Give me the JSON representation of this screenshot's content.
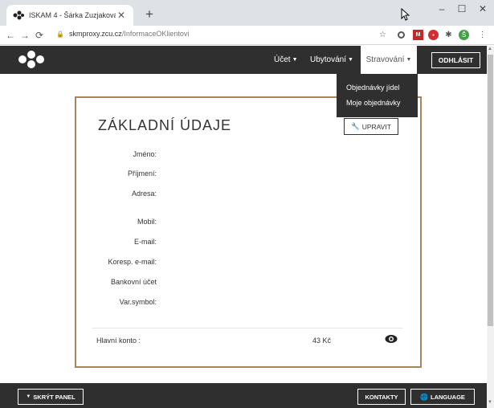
{
  "browser": {
    "tab_title": "ISKAM 4 - Šárka Zuzjaková",
    "url_domain": "skmproxy.zcu.cz",
    "url_path": "/InformaceOKlientovi"
  },
  "header": {
    "nav": [
      "Účet",
      "Ubytování",
      "Stravování"
    ],
    "logout": "ODHLÁSIT"
  },
  "dropdown": {
    "items": [
      "Objednávky jídel",
      "Moje objednávky"
    ]
  },
  "card": {
    "title": "ZÁKLADNÍ ÚDAJE",
    "edit": "UPRAVIT",
    "fields": [
      "Jméno:",
      "Příjmení:",
      "Adresa:",
      "Mobil:",
      "E-mail:",
      "Koresp. e-mail:",
      "Bankovní účet",
      "Var.symbol:"
    ],
    "konto_label": "Hlavní konto :",
    "konto_value": "43 Kč"
  },
  "footer": {
    "hide_panel": "SKRÝT PANEL",
    "contacts": "KONTAKTY",
    "language": "LANGUAGE"
  },
  "colors": {
    "card_border": "#a8845a",
    "header_bg": "#2f2f2f"
  }
}
